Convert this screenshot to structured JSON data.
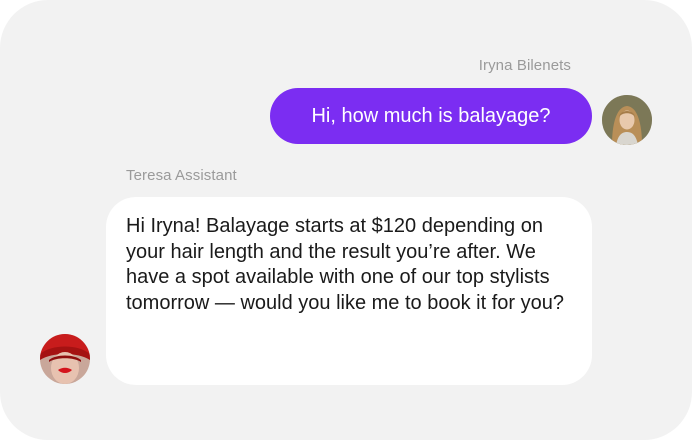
{
  "chat": {
    "user": {
      "name": "Iryna Bilenets",
      "message": "Hi, how much is balayage?",
      "avatar_icon": "woman-portrait-avatar"
    },
    "assistant": {
      "name": "Teresa Assistant",
      "message": "Hi Iryna! Balayage starts at $120 depending on your hair length and the result you’re after. We have a spot available with one of our top stylists tomorrow — would you like me to book it for you?",
      "avatar_icon": "red-hat-woman-avatar"
    }
  },
  "colors": {
    "background": "#f2f2f2",
    "user_bubble": "#7b2df2",
    "assistant_bubble": "#ffffff",
    "name_text": "#9a9a9a"
  }
}
